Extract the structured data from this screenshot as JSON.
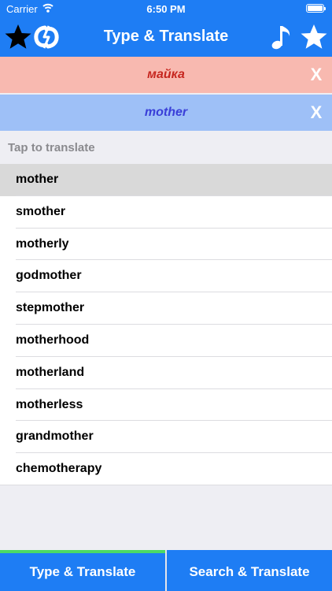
{
  "status_bar": {
    "carrier": "Carrier",
    "time": "6:50 PM"
  },
  "nav": {
    "title": "Type & Translate",
    "left_icons": [
      "star-icon",
      "translate-logo-icon"
    ],
    "right_icons": [
      "music-note-icon",
      "star-icon"
    ]
  },
  "languages": {
    "source_word": "майка",
    "target_word": "mother",
    "clear_label": "X"
  },
  "hint": "Tap to translate",
  "results": [
    "mother",
    "smother",
    "motherly",
    "godmother",
    "stepmother",
    "motherhood",
    "motherland",
    "motherless",
    "grandmother",
    "chemotherapy"
  ],
  "selected_result": "mother",
  "tabs": {
    "type_translate": "Type & Translate",
    "search_translate": "Search & Translate",
    "active": "Type & Translate"
  },
  "colors": {
    "accent": "#1e7df4",
    "source_bg": "#f8b9b0",
    "source_text": "#c6251e",
    "target_bg": "#9ec0f7",
    "target_text": "#3a3fd8",
    "active_tab_indicator": "#4cd964"
  }
}
